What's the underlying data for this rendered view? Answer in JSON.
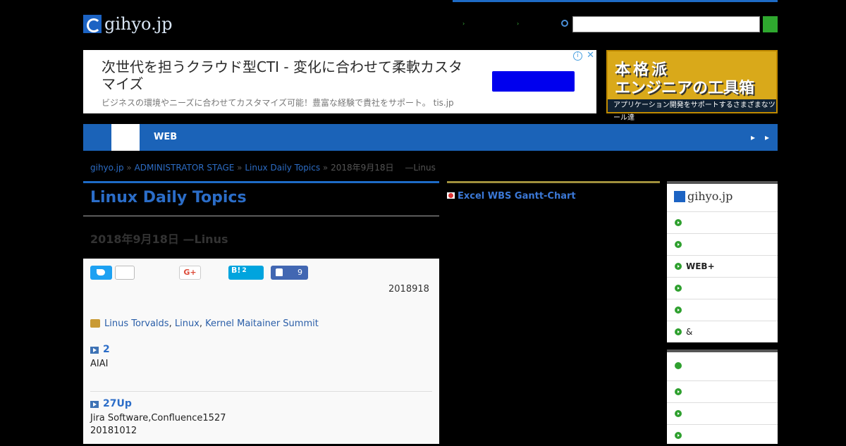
{
  "header": {
    "logo_text": "gihyo.jp",
    "links": [
      "",
      ""
    ],
    "search_placeholder": ""
  },
  "ad": {
    "title": "次世代を担うクラウド型CTI - 変化に合わせて柔軟カスタマイズ",
    "subtitle": "ビジネスの環境やニーズに合わせてカスタマイズ可能！豊富な経験で貴社をサポート。 tis.jp",
    "info_icon": "i",
    "close_icon": "✕"
  },
  "banner": {
    "line1": "本格派",
    "line2": "エンジニアの工具箱",
    "line3": "アプリケーション開発をサポートするさまざまなツール達"
  },
  "nav": {
    "items": [
      "",
      "",
      "WEB",
      ""
    ],
    "right": [
      "",
      ""
    ]
  },
  "breadcrumb": {
    "items": [
      "gihyo.jp",
      "ADMINISTRATOR STAGE",
      "Linux Daily Topics"
    ],
    "current": "2018年9月18日　 —Linus"
  },
  "main": {
    "section_title": "Linux Daily Topics",
    "article_title": "2018年9月18日 —Linus",
    "share": {
      "tweet_count": "",
      "google_label": "G+",
      "hatena_label": "B!",
      "hatena_count": "2",
      "facebook_count": "9"
    },
    "date": "2018918",
    "tags_prefix": "",
    "tags": [
      "Linus Torvalds",
      "Linux",
      "Kernel Maitainer Summit"
    ],
    "sections": [
      {
        "title": "2",
        "text": "AIAI",
        "text2": ""
      },
      {
        "title": "27Up",
        "text": "Jira Software,Confluence1527",
        "text2": "20181012"
      }
    ]
  },
  "middle": {
    "link": "Excel WBS Gantt-Chart"
  },
  "sidebar": {
    "logo_text": "gihyo.jp",
    "items": [
      "",
      "",
      "WEB+",
      "",
      "",
      "&"
    ],
    "box2_title": "",
    "box2_items": [
      "",
      "",
      ""
    ]
  }
}
